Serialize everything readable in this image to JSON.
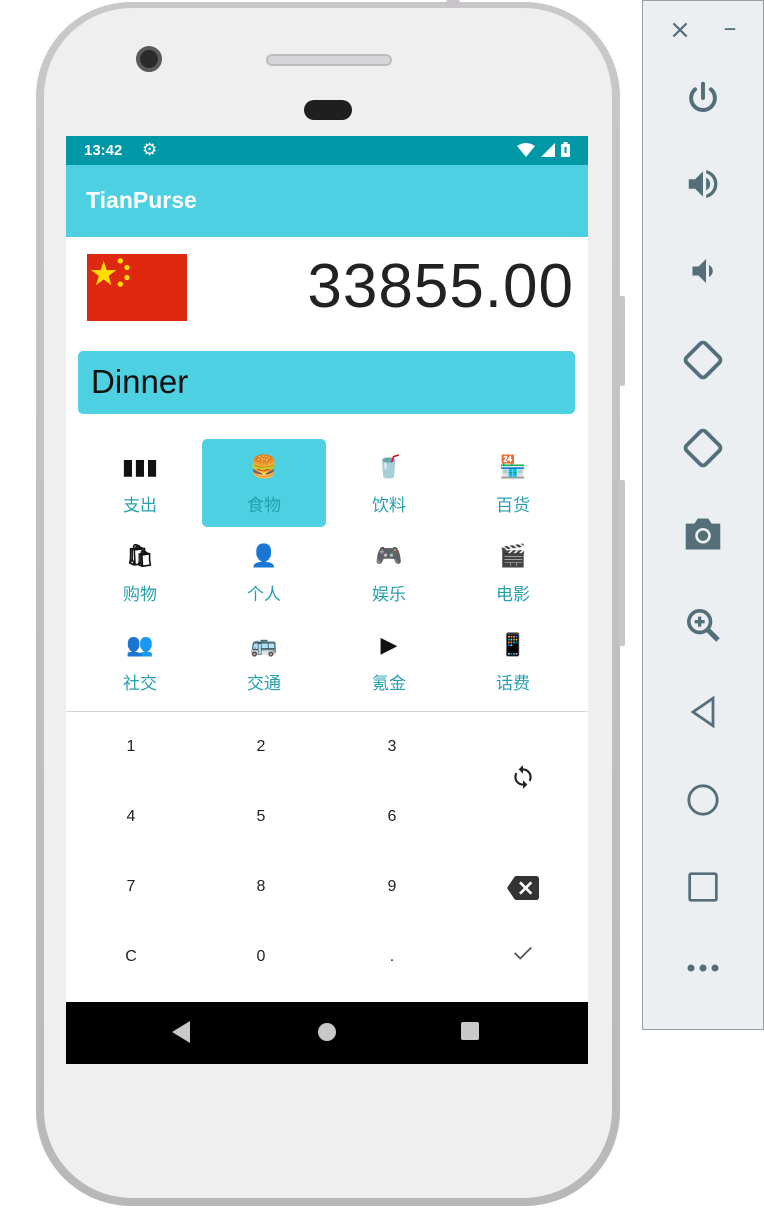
{
  "status": {
    "time": "13:42"
  },
  "app": {
    "title": "TianPurse"
  },
  "amount": "33855.00",
  "memo": "Dinner",
  "categories": [
    {
      "label": "支出",
      "icon": "bars-icon",
      "glyph": "▮▮▮"
    },
    {
      "label": "食物",
      "icon": "fastfood-icon",
      "glyph": "🍔"
    },
    {
      "label": "饮料",
      "icon": "drink-icon",
      "glyph": "🥤"
    },
    {
      "label": "百货",
      "icon": "store-icon",
      "glyph": "🏪"
    },
    {
      "label": "购物",
      "icon": "shopping-bag-icon",
      "glyph": "🛍"
    },
    {
      "label": "个人",
      "icon": "person-icon",
      "glyph": "👤"
    },
    {
      "label": "娱乐",
      "icon": "gamepad-icon",
      "glyph": "🎮"
    },
    {
      "label": "电影",
      "icon": "movie-clapper-icon",
      "glyph": "🎬"
    },
    {
      "label": "社交",
      "icon": "people-icon",
      "glyph": "👥"
    },
    {
      "label": "交通",
      "icon": "commute-icon",
      "glyph": "🚌"
    },
    {
      "label": "氪金",
      "icon": "play-store-icon",
      "glyph": "▶"
    },
    {
      "label": "话费",
      "icon": "phone-icon",
      "glyph": "📱"
    }
  ],
  "selected_category": "食物",
  "keypad": {
    "keys": [
      "1",
      "2",
      "3",
      "4",
      "5",
      "6",
      "7",
      "8",
      "9",
      "C",
      "0",
      "."
    ]
  },
  "colors": {
    "status_bar": "#0097a7",
    "app_bar": "#4dd0e1",
    "accent_text": "#26a0ad"
  }
}
